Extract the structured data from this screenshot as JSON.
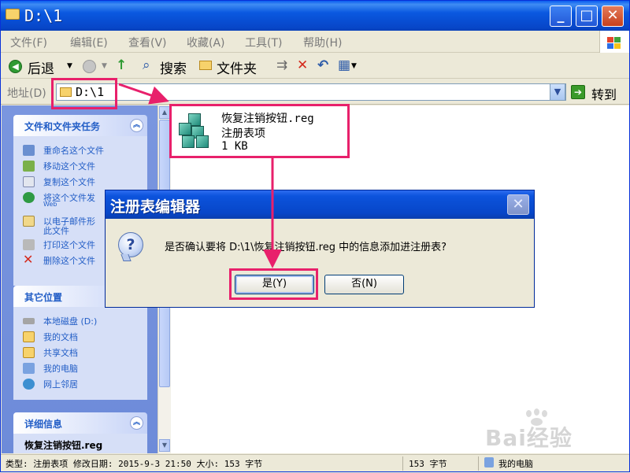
{
  "window": {
    "title": "D:\\1"
  },
  "menu": [
    "文件(F)",
    "编辑(E)",
    "查看(V)",
    "收藏(A)",
    "工具(T)",
    "帮助(H)"
  ],
  "toolbar": {
    "back": "后退",
    "search": "搜索",
    "folders": "文件夹"
  },
  "address": {
    "label": "地址(D)",
    "value": "D:\\1",
    "go": "转到"
  },
  "tasks": {
    "title": "文件和文件夹任务",
    "items": [
      "重命名这个文件",
      "移动这个文件",
      "复制这个文件",
      "将这个文件发",
      "Web",
      "以电子邮件形",
      "此文件",
      "打印这个文件",
      "删除这个文件"
    ]
  },
  "places": {
    "title": "其它位置",
    "items": [
      "本地磁盘 (D:)",
      "我的文档",
      "共享文档",
      "我的电脑",
      "网上邻居"
    ]
  },
  "details": {
    "title": "详细信息",
    "name": "恢复注销按钮.reg"
  },
  "file": {
    "name": "恢复注销按钮.reg",
    "type": "注册表项",
    "size": "1 KB"
  },
  "dialog": {
    "title": "注册表编辑器",
    "message": "是否确认要将 D:\\1\\恢复注销按钮.reg 中的信息添加进注册表?",
    "yes": "是(Y)",
    "no": "否(N)"
  },
  "status": {
    "left": "类型: 注册表项 修改日期: 2015-9-3 21:50 大小: 153 字节",
    "size": "153 字节",
    "zone": "我的电脑"
  },
  "watermark": {
    "text": "Bai经验"
  },
  "colors": {
    "annotation": "#e8206b",
    "titlebar": "#0746c8",
    "link": "#215dc6"
  }
}
